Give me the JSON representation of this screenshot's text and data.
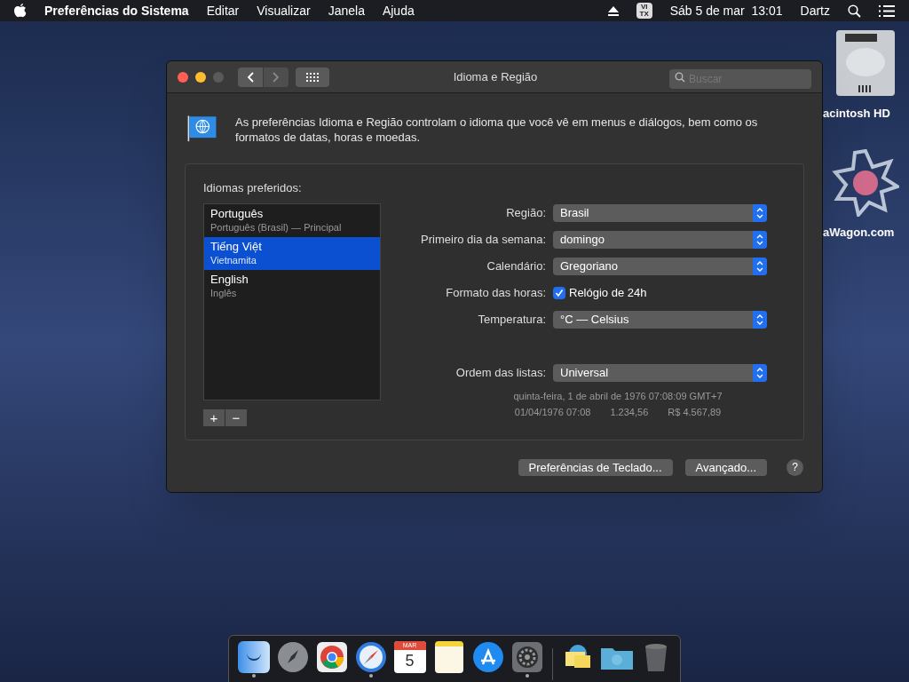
{
  "menubar": {
    "app": "Preferências do Sistema",
    "menus": [
      "Editar",
      "Visualizar",
      "Janela",
      "Ajuda"
    ],
    "input_source": [
      "VI",
      "TX"
    ],
    "clock": "Sáb 5 de mar  13:01",
    "user": "Dartz"
  },
  "desktop_icons": [
    {
      "kind": "disk",
      "label": "acintosh HD"
    },
    {
      "kind": "star",
      "label": "aWagon.com"
    }
  ],
  "window": {
    "title": "Idioma e Região",
    "back_enabled": true,
    "forward_enabled": false,
    "search": {
      "placeholder": "Buscar"
    },
    "intro": "As preferências Idioma e Região controlam o idioma que você vê em menus e diálogos, bem como os formatos de datas, horas e moedas.",
    "languages_label": "Idiomas preferidos:",
    "languages": [
      {
        "name": "Português",
        "detail": "Português (Brasil) — Principal",
        "selected": false
      },
      {
        "name": "Tiếng Việt",
        "detail": "Vietnamita",
        "selected": true
      },
      {
        "name": "English",
        "detail": "Inglês",
        "selected": false
      }
    ],
    "list_buttons": [
      "+",
      "−"
    ],
    "settings": [
      {
        "kind": "popup",
        "label": "Região:",
        "value": "Brasil"
      },
      {
        "kind": "popup",
        "label": "Primeiro dia da semana:",
        "value": "domingo"
      },
      {
        "kind": "popup",
        "label": "Calendário:",
        "value": "Gregoriano"
      },
      {
        "kind": "checkbox",
        "label": "Formato das horas:",
        "value": "Relógio de 24h",
        "checked": true
      },
      {
        "kind": "popup",
        "label": "Temperatura:",
        "value": "°C — Celsius"
      },
      {
        "kind": "spacer"
      },
      {
        "kind": "popup",
        "label": "Ordem das listas:",
        "value": "Universal"
      }
    ],
    "sample_date": "quinta-feira, 1 de abril de 1976 07:08:09 GMT+7",
    "sample_values": [
      "01/04/1976 07:08",
      "1.234,56",
      "R$ 4.567,89"
    ],
    "buttons": [
      "Preferências de Teclado...",
      "Avançado..."
    ],
    "help": "?"
  },
  "dock": [
    {
      "kind": "finder",
      "running": true
    },
    {
      "kind": "rocket",
      "running": false
    },
    {
      "kind": "chrome",
      "running": false
    },
    {
      "kind": "compass",
      "running": true
    },
    {
      "kind": "calendar",
      "running": false,
      "month": "MAR",
      "day": "5"
    },
    {
      "kind": "notes",
      "running": false
    },
    {
      "kind": "appstore",
      "running": false
    },
    {
      "kind": "gear",
      "running": true
    },
    {
      "kind": "separator"
    },
    {
      "kind": "stickies",
      "running": false
    },
    {
      "kind": "folder",
      "running": false
    },
    {
      "kind": "trash",
      "running": false
    }
  ]
}
